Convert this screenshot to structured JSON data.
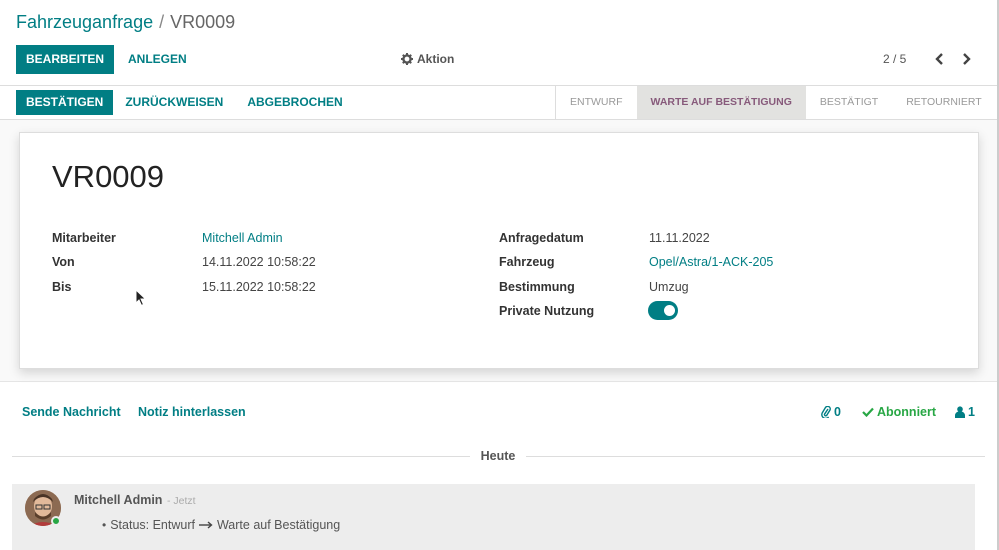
{
  "breadcrumb": {
    "parent": "Fahrzeuganfrage",
    "separator": "/",
    "current": "VR0009"
  },
  "toolbar": {
    "edit_label": "BEARBEITEN",
    "create_label": "ANLEGEN",
    "action_label": "Aktion"
  },
  "pager": {
    "value": "2 / 5"
  },
  "statusbar": {
    "buttons": [
      "BESTÄTIGEN",
      "ZURÜCKWEISEN",
      "ABGEBROCHEN"
    ],
    "stages": [
      "ENTWURF",
      "WARTE AUF BESTÄTIGUNG",
      "BESTÄTIGT",
      "RETOURNIERT"
    ],
    "active_stage": "WARTE AUF BESTÄTIGUNG"
  },
  "record": {
    "name": "VR0009",
    "left_fields": [
      {
        "label": "Mitarbeiter",
        "value": "Mitchell Admin"
      },
      {
        "label": "Von",
        "value": "14.11.2022 10:58:22"
      },
      {
        "label": "Bis",
        "value": "15.11.2022 10:58:22"
      }
    ],
    "right_fields": [
      {
        "label": "Anfragedatum",
        "value": "11.11.2022"
      },
      {
        "label": "Fahrzeug",
        "value": "Opel/Astra/1-ACK-205"
      },
      {
        "label": "Bestimmung",
        "value": "Umzug"
      },
      {
        "label": "Private Nutzung",
        "value": ""
      }
    ],
    "private_use": true
  },
  "chatter": {
    "send_message": "Sende Nachricht",
    "log_note": "Notiz hinterlassen",
    "attachments_count": "0",
    "follow_label": "Abonniert",
    "followers_count": "1",
    "today_label": "Heute",
    "message": {
      "author": "Mitchell Admin",
      "date": "- Jetzt",
      "tracking_label": "Status: Entwurf",
      "tracking_new": "Warte auf Bestätigung"
    }
  },
  "colors": {
    "primary": "#017e84",
    "active_stage": "#875a7b",
    "follow": "#28a745"
  }
}
